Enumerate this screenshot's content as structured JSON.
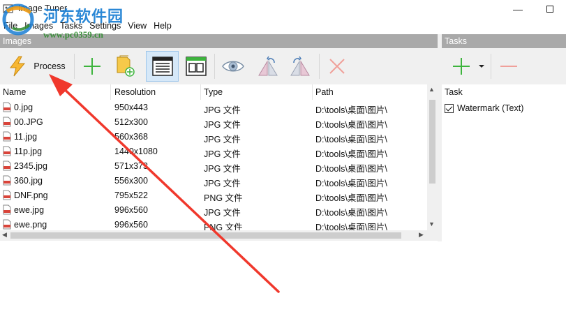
{
  "window": {
    "title": "Image Tuner"
  },
  "watermark": {
    "site_name": "河东软件园",
    "url": "www.pc0359.cn"
  },
  "menu": [
    "File",
    "Images",
    "Tasks",
    "Settings",
    "View",
    "Help"
  ],
  "images_panel": {
    "header": "Images",
    "toolbar": {
      "process_label": "Process",
      "icons": [
        "process-icon",
        "add-icon",
        "add-folder-icon",
        "details-view-icon",
        "thumbnail-view-icon",
        "preview-icon",
        "rotate-left-icon",
        "rotate-right-icon",
        "remove-icon"
      ]
    },
    "columns": [
      "Name",
      "Resolution",
      "Type",
      "Path"
    ],
    "rows": [
      {
        "name": "0.jpg",
        "resolution": "950x443",
        "type": "JPG 文件",
        "path": "D:\\tools\\桌面\\图片\\"
      },
      {
        "name": "00.JPG",
        "resolution": "512x300",
        "type": "JPG 文件",
        "path": "D:\\tools\\桌面\\图片\\"
      },
      {
        "name": "11.jpg",
        "resolution": "560x368",
        "type": "JPG 文件",
        "path": "D:\\tools\\桌面\\图片\\"
      },
      {
        "name": "11p.jpg",
        "resolution": "1440x1080",
        "type": "JPG 文件",
        "path": "D:\\tools\\桌面\\图片\\"
      },
      {
        "name": "2345.jpg",
        "resolution": "571x373",
        "type": "JPG 文件",
        "path": "D:\\tools\\桌面\\图片\\"
      },
      {
        "name": "360.jpg",
        "resolution": "556x300",
        "type": "JPG 文件",
        "path": "D:\\tools\\桌面\\图片\\"
      },
      {
        "name": "DNF.png",
        "resolution": "795x522",
        "type": "PNG 文件",
        "path": "D:\\tools\\桌面\\图片\\"
      },
      {
        "name": "ewe.jpg",
        "resolution": "996x560",
        "type": "JPG 文件",
        "path": "D:\\tools\\桌面\\图片\\"
      },
      {
        "name": "ewe.png",
        "resolution": "996x560",
        "type": "PNG 文件",
        "path": "D:\\tools\\桌面\\图片\\"
      }
    ]
  },
  "tasks_panel": {
    "header": "Tasks",
    "column": "Task",
    "items": [
      {
        "label": "Watermark (Text)",
        "checked": true
      }
    ]
  },
  "colors": {
    "panel_header": "#a9a9a9",
    "toolbar_bg": "#f0f0f0",
    "accent_green": "#3db43d",
    "accent_red": "#e0413a",
    "annotation_arrow": "#f0382c"
  }
}
